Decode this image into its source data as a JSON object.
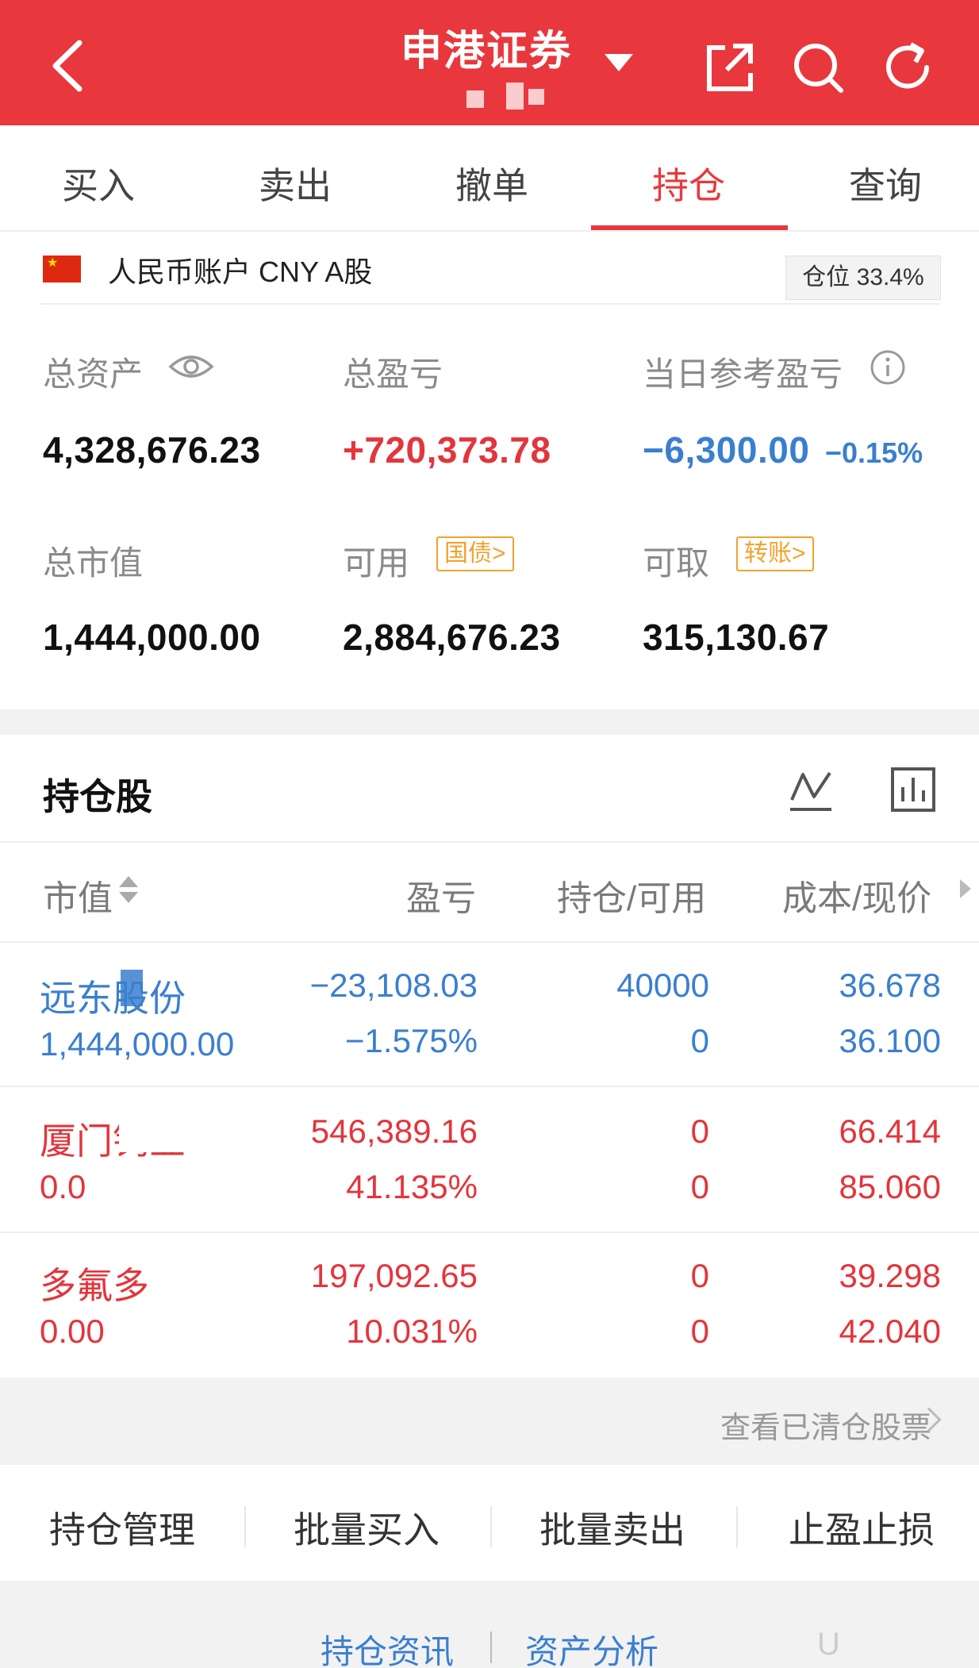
{
  "header": {
    "title": "申港证券",
    "bg_color": "#e8383d"
  },
  "tabs": [
    {
      "label": "买入",
      "active": false
    },
    {
      "label": "卖出",
      "active": false
    },
    {
      "label": "撤单",
      "active": false
    },
    {
      "label": "持仓",
      "active": true
    },
    {
      "label": "查询",
      "active": false
    }
  ],
  "account": {
    "label": "人民币账户 CNY A股",
    "position_label": "仓位 33.4%"
  },
  "summary": {
    "total_assets_label": "总资产",
    "total_assets": "4,328,676.23",
    "total_pnl_label": "总盈亏",
    "total_pnl": "+720,373.78",
    "daily_pnl_label": "当日参考盈亏",
    "daily_pnl": "−6,300.00",
    "daily_pnl_pct": "−0.15%",
    "market_value_label": "总市值",
    "market_value": "1,444,000.00",
    "available_label": "可用",
    "available": "2,884,676.23",
    "available_tag": "国债>",
    "withdrawable_label": "可取",
    "withdrawable": "315,130.67",
    "withdrawable_tag": "转账>"
  },
  "holdings": {
    "title": "持仓股",
    "columns": [
      "市值",
      "盈亏",
      "持仓/可用",
      "成本/现价"
    ],
    "rows": [
      {
        "name": "远东股份",
        "market_value": "1,444,000.00",
        "pnl": "−23,108.03",
        "pnl_pct": "−1.575%",
        "position": "40000",
        "available": "0",
        "cost": "36.678",
        "price": "36.100",
        "color": "blue"
      },
      {
        "name": "厦门钨业",
        "market_value": "0.00",
        "pnl": "546,389.16",
        "pnl_pct": "41.135%",
        "position": "0",
        "available": "0",
        "cost": "66.414",
        "price": "85.060",
        "color": "red"
      },
      {
        "name": "多氟多",
        "market_value": "0.00",
        "pnl": "197,092.65",
        "pnl_pct": "10.031%",
        "position": "0",
        "available": "0",
        "cost": "39.298",
        "price": "42.040",
        "color": "red"
      }
    ],
    "cleared_link": "查看已清仓股票"
  },
  "actions": [
    "持仓管理",
    "批量买入",
    "批量卖出",
    "止盈止损"
  ],
  "footer": {
    "link1": "持仓资讯",
    "link2": "资产分析",
    "watermark": "U"
  }
}
